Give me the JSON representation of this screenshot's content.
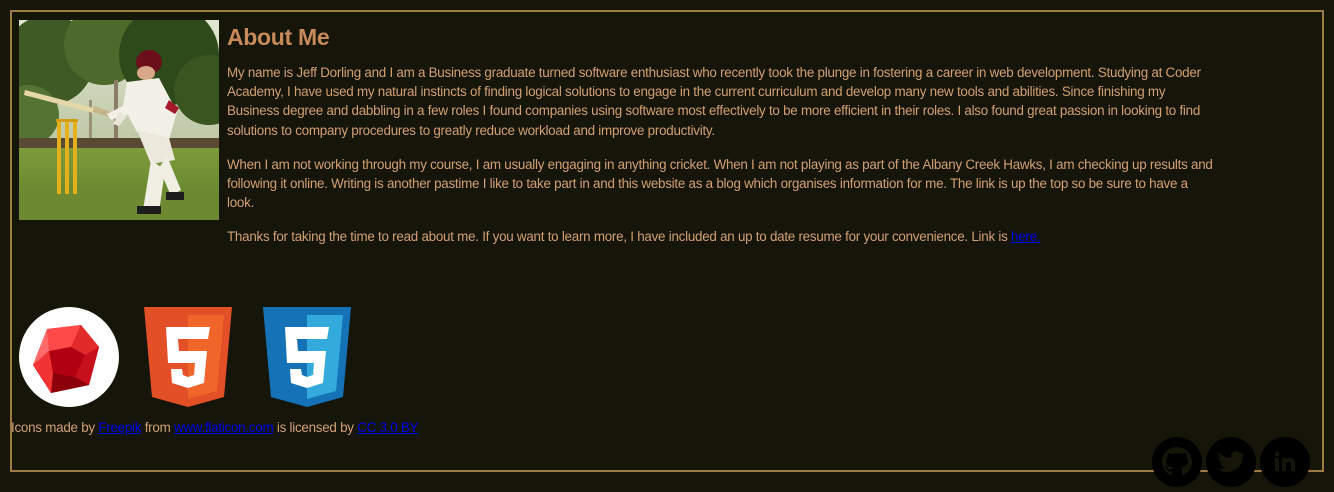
{
  "about": {
    "title": "About Me",
    "photo_icon": "cricket-batsman-photo",
    "paragraph1": "My name is Jeff Dorling and I am a Business graduate turned software enthusiast who recently took the plunge in fostering a career in web development. Studying at Coder Academy, I have used my natural instincts of finding logical solutions to engage in the current curriculum and develop many new tools and abilities. Since finishing my Business degree and dabbling in a few roles I found companies using software most effectively to be more efficient in their roles. I also found great passion in looking to find solutions to company procedures to greatly reduce workload and improve productivity.",
    "paragraph2": "When I am not working through my course, I am usually engaging in anything cricket. When I am not playing as part of the Albany Creek Hawks, I am checking up results and following it online. Writing is another pastime I like to take part in and this website as a blog which organises information for me. The link is up the top so be sure to have a look.",
    "paragraph3_text": "Thanks for taking the time to read about me. If you want to learn more, I have included an up to date resume for your convenience. Link is ",
    "paragraph3_link": "here."
  },
  "tech_icons": [
    "ruby-icon",
    "html5-icon",
    "css3-icon"
  ],
  "attribution": {
    "prefix": "Icons made by ",
    "author_link": "Freepik",
    "from_text": " from ",
    "site_link": "www.flaticon.com",
    "licensed_text": " is licensed by ",
    "license_link": "CC 3.0 BY"
  },
  "social": [
    "github-icon",
    "twitter-icon",
    "linkedin-icon"
  ],
  "colors": {
    "background": "#15150a",
    "text": "#d4a071",
    "title": "#c98a5a",
    "border": "#a07a45",
    "link": "#0000ee"
  }
}
